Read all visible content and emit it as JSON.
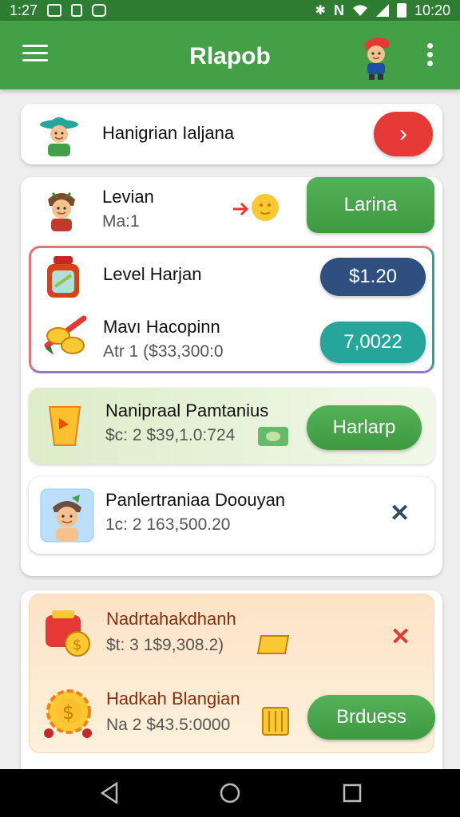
{
  "status_bar": {
    "time": "1:27",
    "clock": "10:20",
    "bluetooth": "✱",
    "signal_letter": "N"
  },
  "app_bar": {
    "title": "Rlapob",
    "menu_icon": "hamburger-menu-icon",
    "more_icon": "kebab-more-icon"
  },
  "top_card": {
    "title": "Hanigrian Ialjana",
    "action_icon": "chevron-right-icon",
    "accent": "#e53935"
  },
  "main_card": {
    "header": {
      "title": "Levian",
      "subtitle": "Ma:1",
      "button_label": "Larina"
    },
    "highlight": {
      "rows": [
        {
          "title": "Level Harjan",
          "value": "$1.20",
          "value_color": "#2f4f7f"
        },
        {
          "title": "Mavı Hacopinn",
          "subtitle": "Atr 1  ($33,300:0",
          "value": "7,0022",
          "value_color": "#26a69a"
        }
      ]
    },
    "green_row": {
      "title": "Nanipraal Pamtanius",
      "subtitle": "$c: 2  $39,1.0:724",
      "button_label": "Harlarp"
    },
    "plain_row": {
      "title": "Panlertraniaa Doouyan",
      "subtitle": "1c: 2  163,500.20",
      "close_icon": "close-x-icon"
    }
  },
  "bottom_card": {
    "row1": {
      "title": "Nadrtahakdhanh",
      "subtitle": "$t: 3  1$9,308.2)",
      "close_icon": "close-x-icon"
    },
    "row2": {
      "title": "Hadkah Blangian",
      "subtitle": "Na 2  $43.5:0000",
      "button_label": "Brduess"
    }
  },
  "nav_bar": {
    "back": "back-icon",
    "home": "home-icon",
    "recents": "recents-icon"
  }
}
